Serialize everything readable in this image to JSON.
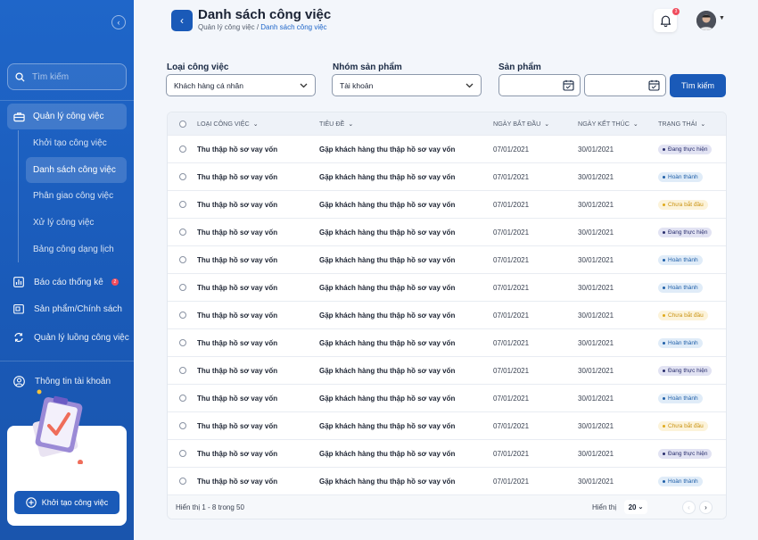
{
  "sidebar": {
    "search_placeholder": "Tìm kiếm",
    "main_item": "Quản lý công việc",
    "sub_items": [
      "Khởi tạo công việc",
      "Danh sách công việc",
      "Phân giao công việc",
      "Xử lý công việc",
      "Bảng công dạng lịch"
    ],
    "report": "Báo cáo thống kê",
    "report_badge": "2",
    "product": "Sản phẩm/Chính sách",
    "workflow": "Quản lý luồng công việc",
    "account": "Thông tin tài khoản",
    "create_button": "Khởi tạo công việc"
  },
  "header": {
    "title": "Danh sách công việc",
    "breadcrumb_parent": "Quản lý công việc /",
    "breadcrumb_current": "Danh sách công việc",
    "notification_count": "3"
  },
  "filters": {
    "type_label": "Loại công việc",
    "type_value": "Khách hàng cá nhân",
    "group_label": "Nhóm sản phẩm",
    "group_value": "Tài khoản",
    "product_label": "Sản phẩm",
    "search_button": "Tìm kiếm"
  },
  "table": {
    "headers": [
      "LOẠI CÔNG VIỆC",
      "TIÊU ĐỀ",
      "NGÀY BẮT ĐẦU",
      "NGÀY KẾT THÚC",
      "TRẠNG THÁI"
    ],
    "rows": [
      {
        "type": "Thu thập hồ sơ vay vốn",
        "title": "Gặp khách hàng thu thập hồ sơ vay vốn",
        "start": "07/01/2021",
        "end": "30/01/2021",
        "status": "Đang thực hiện",
        "kind": "progress"
      },
      {
        "type": "Thu thập hồ sơ vay vốn",
        "title": "Gặp khách hàng thu thập hồ sơ vay vốn",
        "start": "07/01/2021",
        "end": "30/01/2021",
        "status": "Hoàn thành",
        "kind": "done"
      },
      {
        "type": "Thu thập hồ sơ vay vốn",
        "title": "Gặp khách hàng thu thập hồ sơ vay vốn",
        "start": "07/01/2021",
        "end": "30/01/2021",
        "status": "Chưa bắt đầu",
        "kind": "new"
      },
      {
        "type": "Thu thập hồ sơ vay vốn",
        "title": "Gặp khách hàng thu thập hồ sơ vay vốn",
        "start": "07/01/2021",
        "end": "30/01/2021",
        "status": "Đang thực hiện",
        "kind": "progress"
      },
      {
        "type": "Thu thập hồ sơ vay vốn",
        "title": "Gặp khách hàng thu thập hồ sơ vay vốn",
        "start": "07/01/2021",
        "end": "30/01/2021",
        "status": "Hoàn thành",
        "kind": "done"
      },
      {
        "type": "Thu thập hồ sơ vay vốn",
        "title": "Gặp khách hàng thu thập hồ sơ vay vốn",
        "start": "07/01/2021",
        "end": "30/01/2021",
        "status": "Hoàn thành",
        "kind": "done"
      },
      {
        "type": "Thu thập hồ sơ vay vốn",
        "title": "Gặp khách hàng thu thập hồ sơ vay vốn",
        "start": "07/01/2021",
        "end": "30/01/2021",
        "status": "Chưa bắt đầu",
        "kind": "new"
      },
      {
        "type": "Thu thập hồ sơ vay vốn",
        "title": "Gặp khách hàng thu thập hồ sơ vay vốn",
        "start": "07/01/2021",
        "end": "30/01/2021",
        "status": "Hoàn thành",
        "kind": "done"
      },
      {
        "type": "Thu thập hồ sơ vay vốn",
        "title": "Gặp khách hàng thu thập hồ sơ vay vốn",
        "start": "07/01/2021",
        "end": "30/01/2021",
        "status": "Đang thực hiện",
        "kind": "progress"
      },
      {
        "type": "Thu thập hồ sơ vay vốn",
        "title": "Gặp khách hàng thu thập hồ sơ vay vốn",
        "start": "07/01/2021",
        "end": "30/01/2021",
        "status": "Hoàn thành",
        "kind": "done"
      },
      {
        "type": "Thu thập hồ sơ vay vốn",
        "title": "Gặp khách hàng thu thập hồ sơ vay vốn",
        "start": "07/01/2021",
        "end": "30/01/2021",
        "status": "Chưa bắt đầu",
        "kind": "new"
      },
      {
        "type": "Thu thập hồ sơ vay vốn",
        "title": "Gặp khách hàng thu thập hồ sơ vay vốn",
        "start": "07/01/2021",
        "end": "30/01/2021",
        "status": "Đang thực hiện",
        "kind": "progress"
      },
      {
        "type": "Thu thập hồ sơ vay vốn",
        "title": "Gặp khách hàng thu thập hồ sơ vay vốn",
        "start": "07/01/2021",
        "end": "30/01/2021",
        "status": "Hoàn thành",
        "kind": "done"
      }
    ],
    "footer_info": "Hiển thị 1 - 8 trong 50",
    "per_page_label": "Hiển thị",
    "per_page_value": "20"
  },
  "colors": {
    "primary": "#1a5ab8",
    "sidebar": "#1f66c9",
    "status_progress": "#2a2f6e",
    "status_done": "#1f5fa8",
    "status_new": "#e0a91a"
  }
}
